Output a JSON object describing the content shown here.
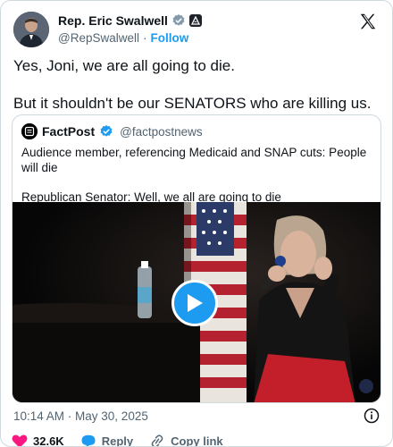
{
  "author": {
    "display_name": "Rep. Eric Swalwell",
    "handle": "@RepSwalwell",
    "separator": "·",
    "follow_label": "Follow",
    "verified_icon": "verified-badge-icon",
    "affiliation_icon": "government-badge-icon"
  },
  "tweet": {
    "paragraphs": [
      "Yes, Joni, we are all going to die.",
      "But it shouldn't be our SENATORS who are killing us."
    ]
  },
  "quote": {
    "display_name": "FactPost",
    "handle": "@factpostnews",
    "lines": [
      "Audience member, referencing Medicaid and SNAP cuts: People will die",
      "Republican Senator: Well, we all are going to die"
    ],
    "video": {
      "play_icon": "play-icon"
    }
  },
  "meta": {
    "timestamp": "10:14 AM · May 30, 2025"
  },
  "actions": {
    "like_count": "32.6K",
    "reply_label": "Reply",
    "copy_label": "Copy link"
  },
  "colors": {
    "accent": "#1d9bf0",
    "like": "#f91880",
    "text": "#0f1419",
    "muted": "#536471"
  }
}
